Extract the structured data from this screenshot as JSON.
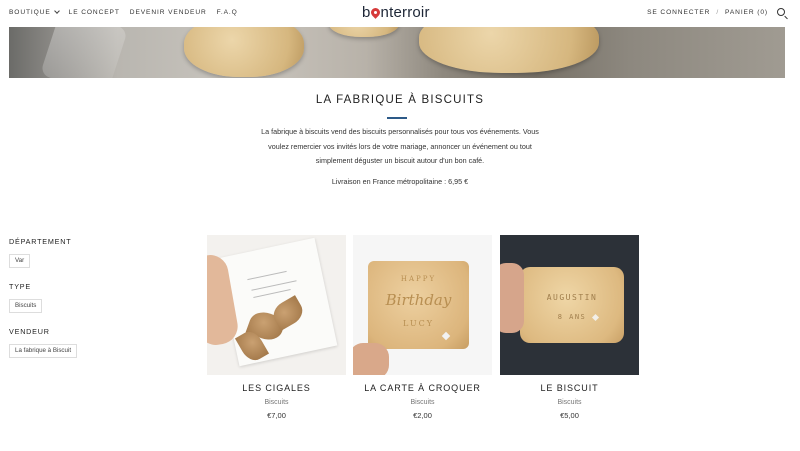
{
  "header": {
    "nav_left": [
      "BOUTIQUE",
      "LE CONCEPT",
      "DEVENIR VENDEUR",
      "F.A.Q"
    ],
    "logo": "bonterroir",
    "login": "SE CONNECTER",
    "separator": "/",
    "cart": "PANIER (0)",
    "icons": [
      "chevron-down-icon",
      "search-icon",
      "location-pin-icon"
    ]
  },
  "collection": {
    "title": "LA FABRIQUE À BISCUITS",
    "description": "La fabrique à biscuits vend des biscuits personnalisés pour tous vos événements. Vous voulez remercier vos invités lors de votre mariage, annoncer un événement ou tout simplement déguster un biscuit autour d'un bon café.",
    "delivery": "Livraison en France métropolitaine : 6,95 €"
  },
  "filters": [
    {
      "label": "DÉPARTEMENT",
      "value": "Var"
    },
    {
      "label": "TYPE",
      "value": "Biscuits"
    },
    {
      "label": "VENDEUR",
      "value": "La fabrique à Biscuit"
    }
  ],
  "products": [
    {
      "name": "LES CIGALES",
      "type": "Biscuits",
      "price": "€7,00"
    },
    {
      "name": "LA CARTE À CROQUER",
      "type": "Biscuits",
      "price": "€2,00",
      "image_text": [
        "HAPPY",
        "Birthday",
        "LUCY"
      ]
    },
    {
      "name": "LE BISCUIT",
      "type": "Biscuits",
      "price": "€5,00",
      "image_text": [
        "AUGUSTIN",
        "8 ANS"
      ]
    }
  ],
  "colors": {
    "accent_rule": "#2d5a88",
    "logo_pin": "#d63a3a"
  }
}
